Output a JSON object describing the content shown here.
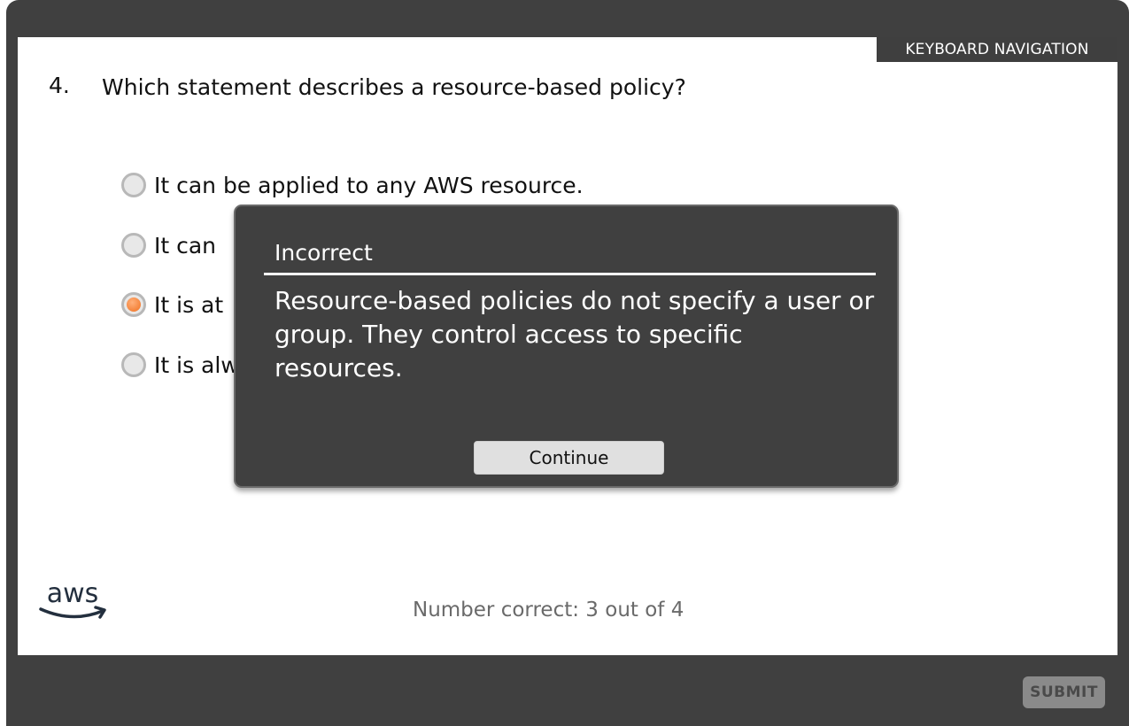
{
  "header": {
    "keyboard_nav_label": "KEYBOARD NAVIGATION"
  },
  "question": {
    "number": "4.",
    "text": "Which statement describes a resource-based policy?",
    "options": [
      {
        "label": "It can be applied to any AWS resource.",
        "selected": false
      },
      {
        "label": "It can ",
        "selected": false
      },
      {
        "label": "It is at",
        "selected": true
      },
      {
        "label": "It is alw",
        "selected": false
      }
    ]
  },
  "feedback": {
    "title": "Incorrect",
    "body": "Resource-based policies do not specify a user or group. They control access to specific resources.",
    "continue_label": "Continue"
  },
  "footer": {
    "logo": "aws",
    "score_text": "Number correct: 3 out of 4",
    "submit_label": "SUBMIT"
  },
  "colors": {
    "frame": "#404040",
    "selected_radio": "#f07020",
    "modal_bg": "#404040"
  }
}
